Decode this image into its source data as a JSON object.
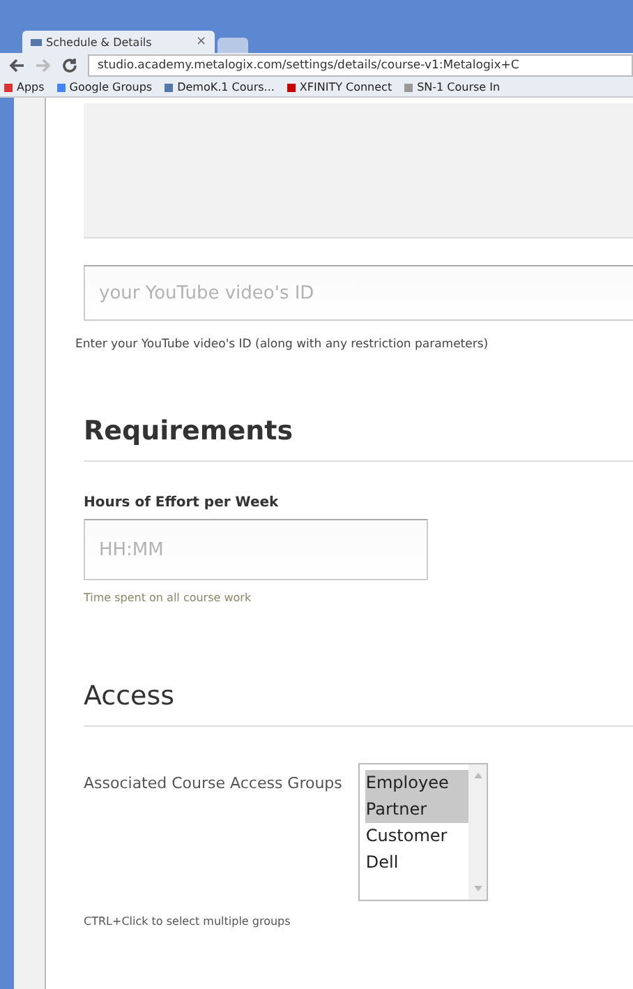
{
  "browser": {
    "tabs": [
      {
        "kind": "page",
        "label": "Schedule & Details",
        "close": "×",
        "selected": true
      },
      {
        "kind": "new",
        "selected": false
      }
    ],
    "url": "studio.academy.metalogix.com/settings/details/course-v1:Metalogix+C",
    "bookmarks": [
      {
        "label": "Apps",
        "kind": "apps"
      },
      {
        "label": "Google Groups",
        "kind": "google"
      },
      {
        "label": "DemoK.1 Cours...",
        "kind": "course"
      },
      {
        "label": "XFINITY Connect",
        "kind": "xfinity"
      },
      {
        "label": "SN-1 Course In",
        "kind": "page"
      }
    ]
  },
  "video": {
    "placeholder": "your YouTube video's ID",
    "help": "Enter your YouTube video's ID (along with any restriction parameters)"
  },
  "requirements": {
    "heading": "Requirements",
    "label": "Hours of Effort per Week",
    "placeholder": "HH:MM",
    "help": "Time spent on all course work"
  },
  "access": {
    "heading": "Access",
    "label": "Associated Course Access Groups",
    "options": [
      {
        "label": "Employee",
        "selected": true
      },
      {
        "label": "Partner",
        "selected": true
      },
      {
        "label": "Customer",
        "selected": false
      },
      {
        "label": "Dell",
        "selected": false
      }
    ],
    "help": "CTRL+Click to select multiple groups"
  }
}
